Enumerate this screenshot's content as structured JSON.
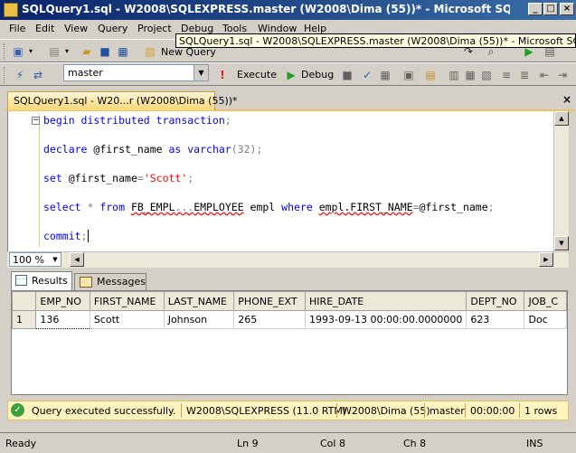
{
  "window": {
    "title": "SQLQuery1.sql - W2008\\SQLEXPRESS.master (W2008\\Dima (55))* - Microsoft SQL Server Manag...",
    "tooltip": "SQLQuery1.sql - W2008\\SQLEXPRESS.master (W2008\\Dima (55))* - Microsoft SQL Server Ma"
  },
  "menu": [
    "File",
    "Edit",
    "View",
    "Query",
    "Project",
    "Debug",
    "Tools",
    "Window",
    "Help"
  ],
  "toolbar": {
    "new_query_label": "New Query",
    "database": "master",
    "execute_label": "Execute",
    "debug_label": "Debug"
  },
  "document_tab": {
    "label": "SQLQuery1.sql - W20...r (W2008\\Dima (55))*"
  },
  "code": {
    "line1": {
      "k1": "begin distributed transaction",
      "p": ";"
    },
    "line2": {
      "k1": "declare ",
      "v": "@first_name ",
      "k2": "as varchar",
      "p": "(32);"
    },
    "line3": {
      "k1": "set ",
      "v": "@first_name",
      "p": "=",
      "s": "'Scott'",
      "e": ";"
    },
    "line4": {
      "k1": "select ",
      "star": "* ",
      "k2": "from ",
      "t1": "FB_EMPL",
      "dots": "...",
      "t2": "EMPLOYEE",
      "alias": " empl ",
      "k3": "where ",
      "col": "empl.FIRST_NAME",
      "eq": "=",
      "v": "@first_name",
      "e": ";"
    },
    "line5": {
      "k1": "commit",
      "p": ";"
    }
  },
  "zoom": "100 %",
  "results": {
    "results_tab": "Results",
    "messages_tab": "Messages",
    "columns": [
      "EMP_NO",
      "FIRST_NAME",
      "LAST_NAME",
      "PHONE_EXT",
      "HIRE_DATE",
      "DEPT_NO",
      "JOB_C"
    ],
    "rows": [
      {
        "num": "1",
        "cells": [
          "136",
          "Scott",
          "Johnson",
          "265",
          "1993-09-13 00:00:00.0000000",
          "623",
          "Doc"
        ]
      }
    ]
  },
  "query_status": {
    "message": "Query executed successfully.",
    "server": "W2008\\SQLEXPRESS (11.0 RTM)",
    "user": "W2008\\Dima (55)",
    "database": "master",
    "time": "00:00:00",
    "rows": "1 rows"
  },
  "status_bar": {
    "state": "Ready",
    "line": "Ln 9",
    "col": "Col 8",
    "ch": "Ch 8",
    "mode": "INS"
  },
  "colors": {
    "keyword": "#0000ff",
    "string": "#ff0000",
    "tab_accent": "#f8d878",
    "status_bg": "#fff3bf"
  }
}
